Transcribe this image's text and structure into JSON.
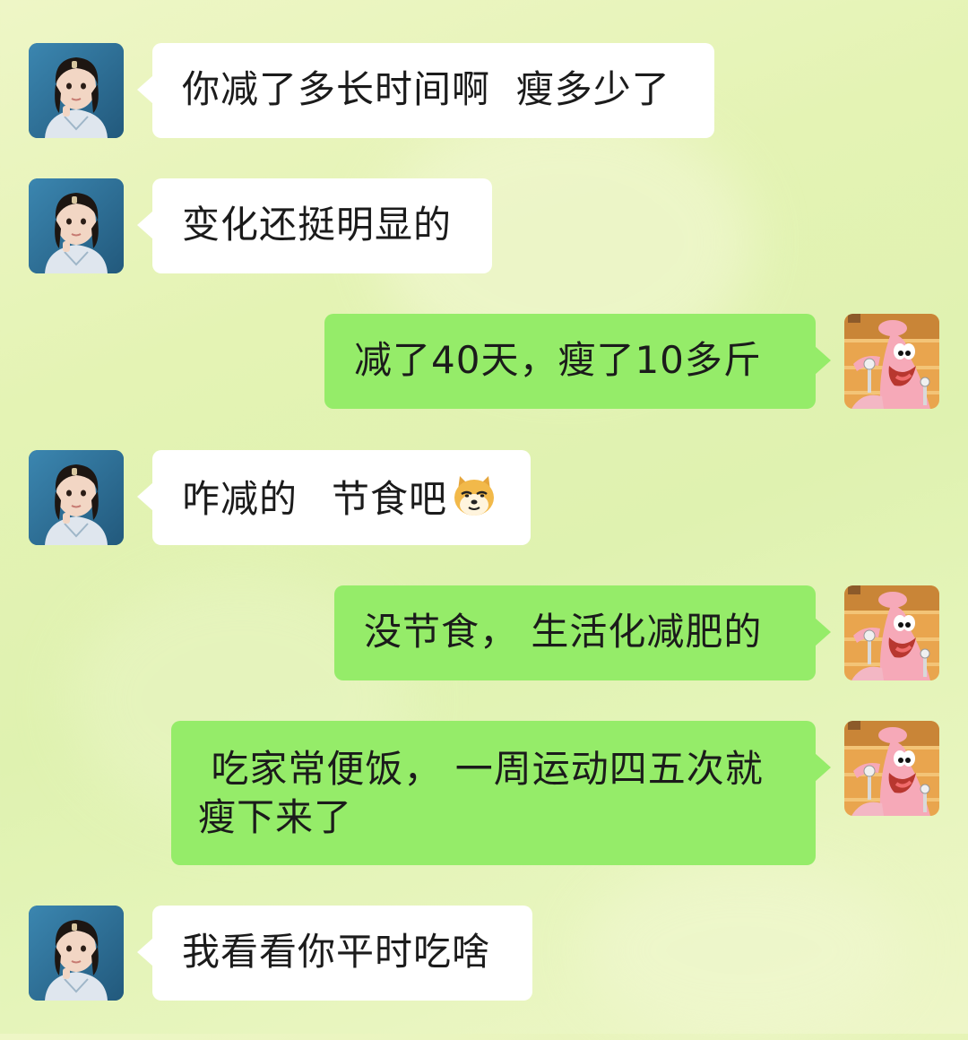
{
  "messages": [
    {
      "side": "left",
      "text": "你减了多长时间啊  瘦多少了"
    },
    {
      "side": "left",
      "text": "变化还挺明显的"
    },
    {
      "side": "right",
      "text": "减了40天，瘦了10多斤"
    },
    {
      "side": "left",
      "text_a": "咋减的",
      "text_b": "节食吧",
      "emoji": "doge-emoji"
    },
    {
      "side": "right",
      "text": "没节食， 生活化减肥的"
    },
    {
      "side": "right",
      "line1": " 吃家常便饭， 一周运动四五次就",
      "line2": "瘦下来了"
    },
    {
      "side": "left",
      "text": "我看看你平时吃啥"
    }
  ],
  "colors": {
    "incoming_bubble": "#ffffff",
    "outgoing_bubble": "#95ec69",
    "text": "#1b1b1b"
  },
  "icons": {
    "left_avatar": "girl-avatar",
    "right_avatar": "patrick-cartoon-avatar"
  }
}
